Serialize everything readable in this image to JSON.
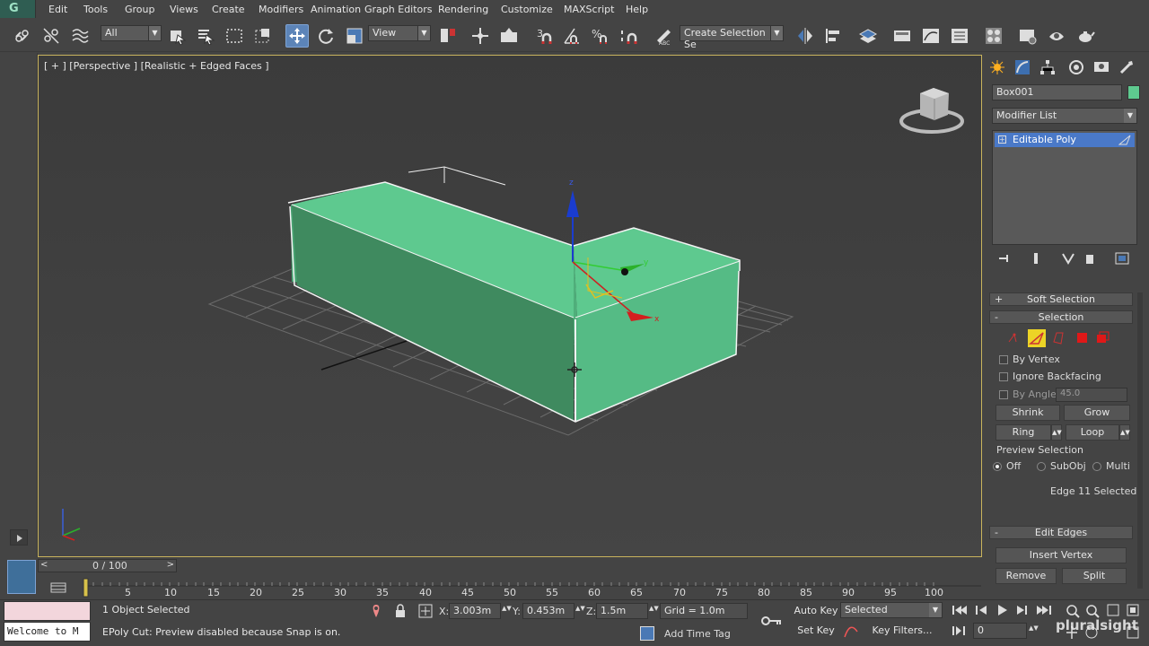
{
  "app": {
    "logo_text": "G",
    "watermark": "pluralsight"
  },
  "menu": [
    "Edit",
    "Tools",
    "Group",
    "Views",
    "Create",
    "Modifiers",
    "Animation",
    "Graph Editors",
    "Rendering",
    "Customize",
    "MAXScript",
    "Help"
  ],
  "toolbar": {
    "selection_filter": "All",
    "ref_coord": "View",
    "named_selection": "Create Selection Se",
    "snap_label": "3",
    "icons": [
      "link-icon",
      "unlink-icon",
      "bind-spacewarp-icon",
      "select-object-icon",
      "select-by-name-icon",
      "rect-region-icon",
      "window-crossing-icon",
      "move-icon",
      "rotate-icon",
      "scale-icon",
      "pivot-icon",
      "manipulate-icon",
      "keyboard-shortcut-icon",
      "snap-icon",
      "angle-snap-icon",
      "percent-snap-icon",
      "spinner-snap-icon",
      "edit-named-sel-icon",
      "mirror-icon",
      "align-icon",
      "layer-icon",
      "graphite-icon",
      "curve-editor-icon",
      "schematic-icon",
      "material-editor-icon",
      "render-setup-icon",
      "rendered-frame-icon",
      "render-icon",
      "teapot-icon"
    ]
  },
  "viewport": {
    "label": "[ + ] [Perspective ] [Realistic + Edged Faces ]",
    "object_color": "#5ec98f",
    "gizmo": {
      "x": "x",
      "y": "y",
      "z": "z"
    }
  },
  "command_panel": {
    "object_name": "Box001",
    "object_color": "#5ec98f",
    "modifier_list": "Modifier List",
    "stack_item": "Editable Poly",
    "soft_selection": "Soft Selection",
    "selection_rollout": "Selection",
    "by_vertex": "By Vertex",
    "ignore_backfacing": "Ignore Backfacing",
    "by_angle": "By Angle:",
    "angle_value": "45.0",
    "shrink": "Shrink",
    "grow": "Grow",
    "ring": "Ring",
    "loop": "Loop",
    "preview_selection": "Preview Selection",
    "preview_off": "Off",
    "preview_subobj": "SubObj",
    "preview_multi": "Multi",
    "selection_status": "Edge 11 Selected",
    "edit_edges": "Edit Edges",
    "insert_vertex": "Insert Vertex",
    "remove": "Remove",
    "split": "Split"
  },
  "timeline": {
    "frame_label": "0 / 100",
    "ticks": [
      "5",
      "10",
      "15",
      "20",
      "25",
      "30",
      "35",
      "40",
      "45",
      "50",
      "55",
      "60",
      "65",
      "70",
      "75",
      "80",
      "85",
      "90",
      "95",
      "100"
    ]
  },
  "status": {
    "listener_text": "Welcome to M",
    "objects_selected": "1 Object Selected",
    "prompt": "EPoly Cut: Preview disabled because Snap is on.",
    "x_label": "X:",
    "x_value": "3.003m",
    "y_label": "Y:",
    "y_value": "0.453m",
    "z_label": "Z:",
    "z_value": "1.5m",
    "grid": "Grid = 1.0m",
    "add_time_tag": "Add Time Tag",
    "auto_key": "Auto Key",
    "set_key": "Set Key",
    "key_mode": "Selected",
    "key_filters": "Key Filters...",
    "current_frame": "0"
  }
}
